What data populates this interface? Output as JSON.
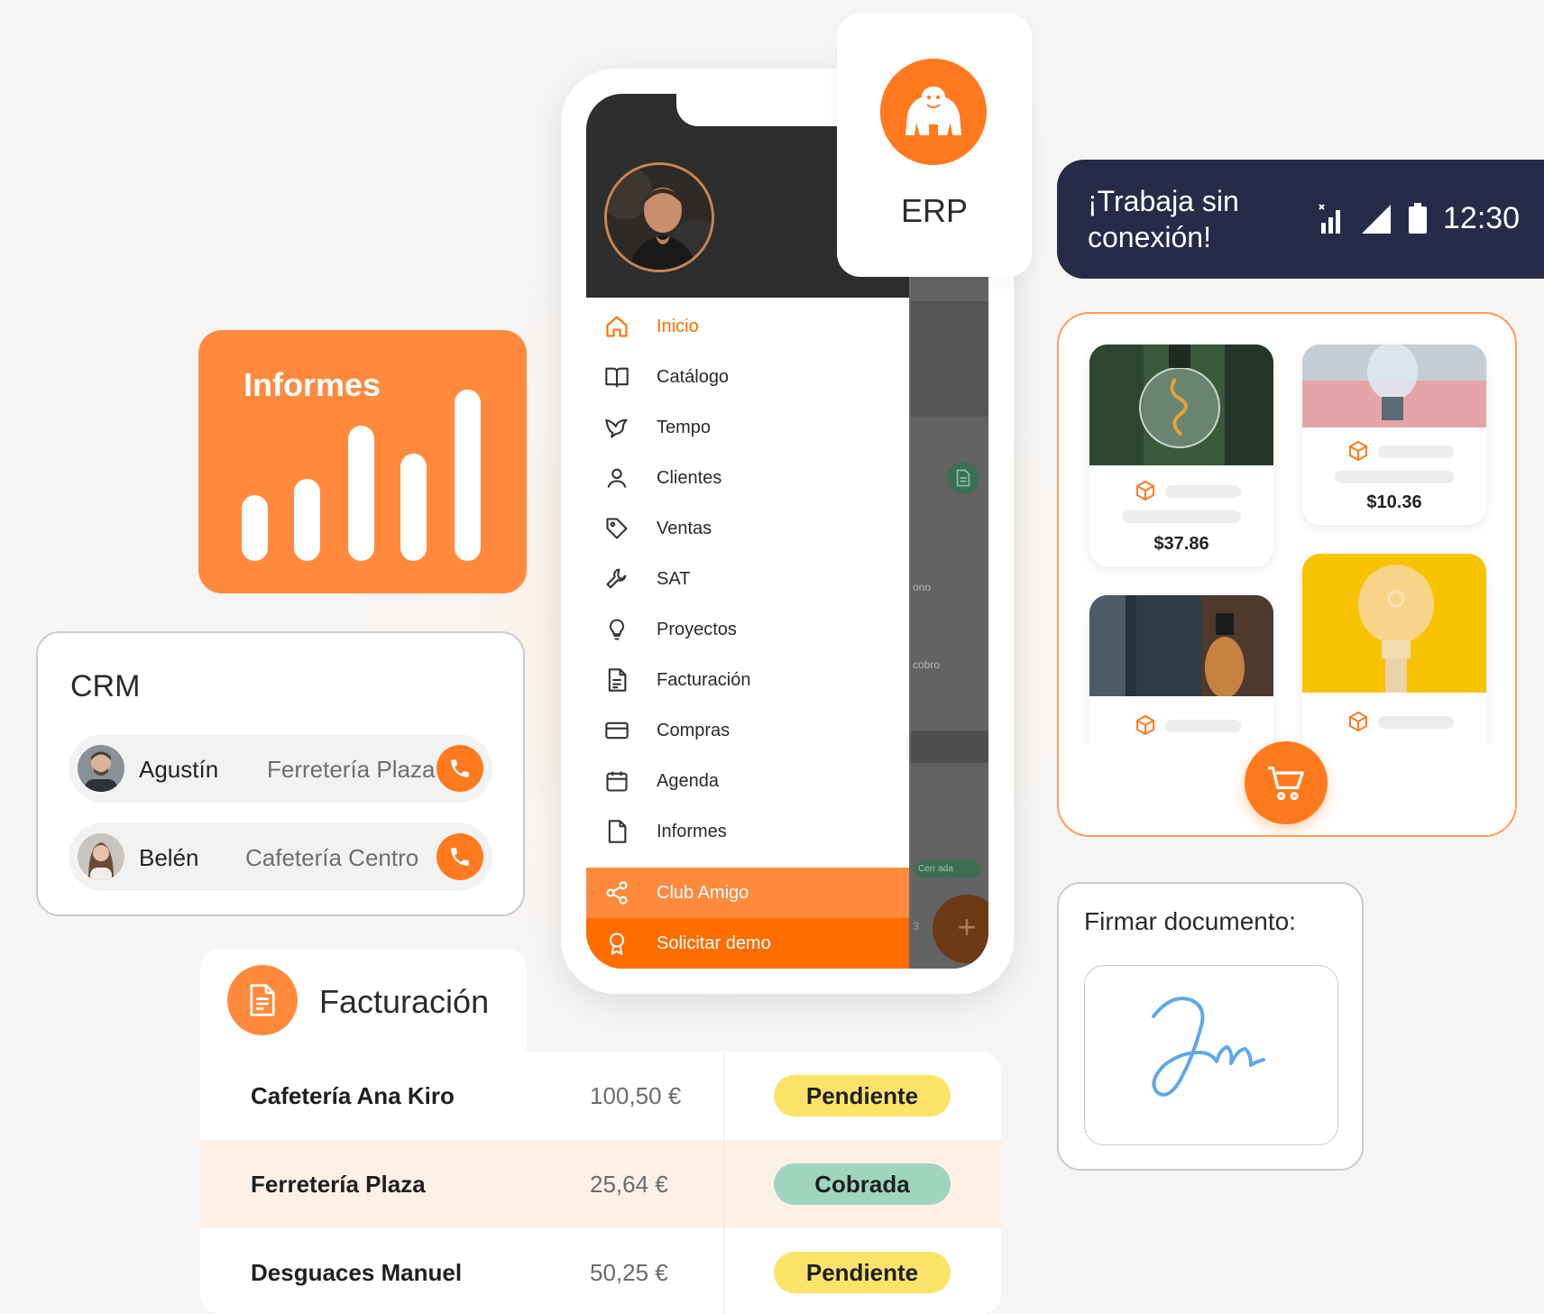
{
  "informes": {
    "title": "Informes",
    "bars": [
      0.33,
      0.41,
      0.68,
      0.54,
      0.86
    ]
  },
  "crm": {
    "title": "CRM",
    "contacts": [
      {
        "name": "Agustín",
        "company": "Ferretería Plaza"
      },
      {
        "name": "Belén",
        "company": "Cafetería Centro"
      }
    ]
  },
  "erp": {
    "label": "ERP"
  },
  "offline": {
    "message": "¡Trabaja sin conexión!",
    "time": "12:30"
  },
  "menu": {
    "items": [
      {
        "label": "Inicio",
        "icon": "home-icon"
      },
      {
        "label": "Catálogo",
        "icon": "book-icon"
      },
      {
        "label": "Tempo",
        "icon": "bird-icon"
      },
      {
        "label": "Clientes",
        "icon": "user-icon"
      },
      {
        "label": "Ventas",
        "icon": "tag-icon"
      },
      {
        "label": "SAT",
        "icon": "wrench-icon"
      },
      {
        "label": "Proyectos",
        "icon": "bulb-icon"
      },
      {
        "label": "Facturación",
        "icon": "invoice-icon"
      },
      {
        "label": "Compras",
        "icon": "card-icon"
      },
      {
        "label": "Agenda",
        "icon": "calendar-icon"
      },
      {
        "label": "Informes",
        "icon": "file-icon"
      }
    ],
    "club": "Club Amigo",
    "demo": "Solicitar demo"
  },
  "underlay": {
    "text1": "ono",
    "text2": "cobro",
    "pill": "Cerr ada",
    "num": "3"
  },
  "catalog": {
    "products": [
      {
        "price": "$37.86"
      },
      {
        "price": "$10.36"
      },
      {
        "price": ""
      },
      {
        "price": ""
      }
    ]
  },
  "sign": {
    "title": "Firmar documento:"
  },
  "facturacion": {
    "title": "Facturación",
    "rows": [
      {
        "client": "Cafetería Ana Kiro",
        "amount": "100,50 €",
        "status": "Pendiente"
      },
      {
        "client": "Ferretería Plaza",
        "amount": "25,64 €",
        "status": "Cobrada"
      },
      {
        "client": "Desguaces Manuel",
        "amount": "50,25 €",
        "status": "Pendiente"
      }
    ]
  },
  "colors": {
    "accent": "#ff7a1f",
    "pending": "#fbe36a",
    "paid": "#9fd5bf",
    "dark": "#282b48"
  }
}
